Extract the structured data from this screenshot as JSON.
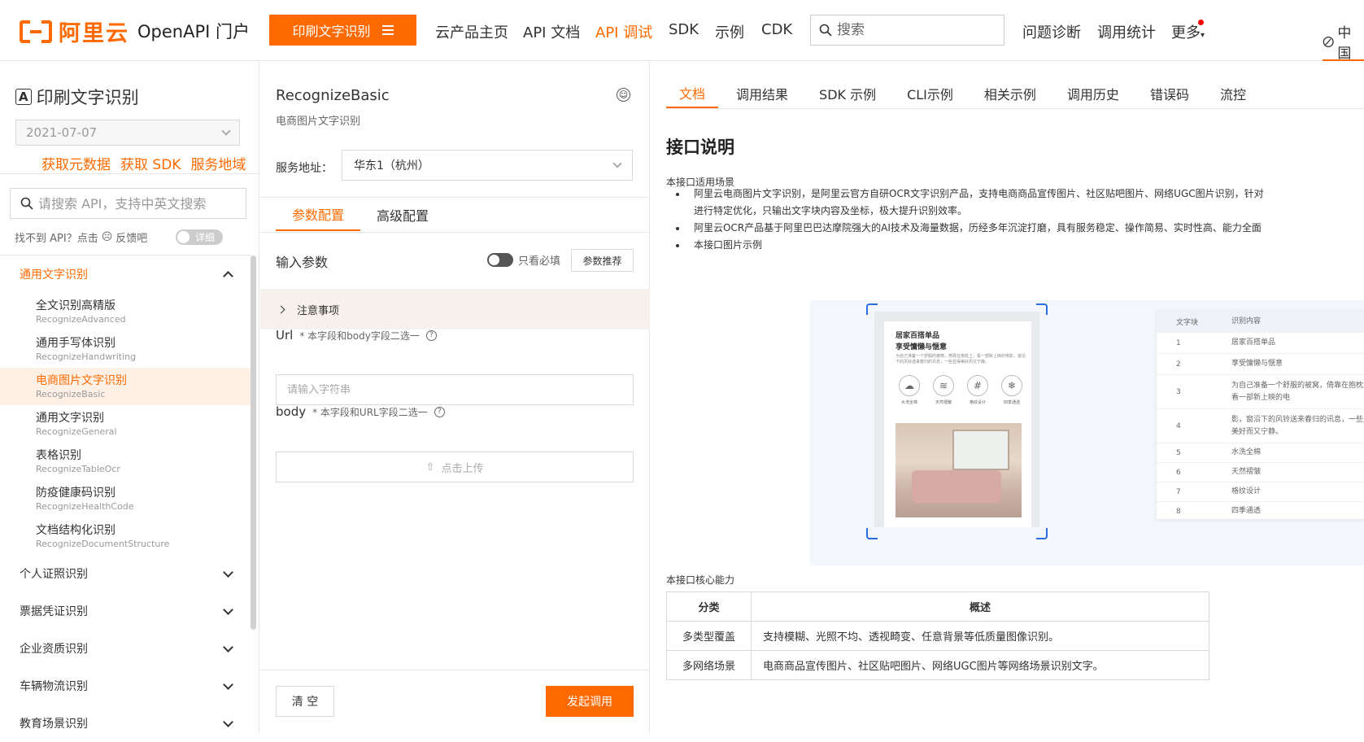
{
  "header": {
    "brand": "阿里云",
    "portal": "OpenAPI 门户",
    "product_button": "印刷文字识别",
    "nav": [
      {
        "label": "云产品主页",
        "active": false
      },
      {
        "label": "API 文档",
        "active": false
      },
      {
        "label": "API 调试",
        "active": true
      },
      {
        "label": "SDK",
        "active": false
      },
      {
        "label": "示例",
        "active": false
      },
      {
        "label": "CDK",
        "active": false
      }
    ],
    "search_placeholder": "搜索",
    "right_links": [
      "问题诊断",
      "调用统计",
      "更多"
    ],
    "region": "中国"
  },
  "sidebar": {
    "title": "印刷文字识别",
    "version": "2021-07-07",
    "links": [
      "获取元数据",
      "获取 SDK",
      "服务地域"
    ],
    "search_placeholder": "请搜索 API，支持中英文搜索",
    "feedback_text": "找不到 API？点击",
    "feedback_link": "反馈吧",
    "detail_toggle": "详细",
    "categories": [
      {
        "label": "通用文字识别",
        "open": true
      },
      {
        "label": "个人证照识别",
        "open": false
      },
      {
        "label": "票据凭证识别",
        "open": false
      },
      {
        "label": "企业资质识别",
        "open": false
      },
      {
        "label": "车辆物流识别",
        "open": false
      },
      {
        "label": "教育场景识别",
        "open": false
      }
    ],
    "items": [
      {
        "zh": "全文识别高精版",
        "en": "RecognizeAdvanced",
        "active": false
      },
      {
        "zh": "通用手写体识别",
        "en": "RecognizeHandwriting",
        "active": false
      },
      {
        "zh": "电商图片文字识别",
        "en": "RecognizeBasic",
        "active": true
      },
      {
        "zh": "通用文字识别",
        "en": "RecognizeGeneral",
        "active": false
      },
      {
        "zh": "表格识别",
        "en": "RecognizeTableOcr",
        "active": false
      },
      {
        "zh": "防疫健康码识别",
        "en": "RecognizeHealthCode",
        "active": false
      },
      {
        "zh": "文档结构化识别",
        "en": "RecognizeDocumentStructure",
        "active": false
      }
    ]
  },
  "middle": {
    "api_name": "RecognizeBasic",
    "api_desc": "电商图片文字识别",
    "service_label": "服务地址：",
    "service_value": "华东1（杭州）",
    "tabs": [
      "参数配置",
      "高级配置"
    ],
    "input_params": "输入参数",
    "required_only": "只看必填",
    "recommend": "参数推荐",
    "notice": "注意事项",
    "url_label": "Url",
    "url_hint": "* 本字段和body字段二选一",
    "url_placeholder": "请输入字符串",
    "body_label": "body",
    "body_hint": "* 本字段和URL字段二选一",
    "upload": "点击上传",
    "clear": "清 空",
    "call": "发起调用"
  },
  "doc": {
    "tabs": [
      "文档",
      "调用结果",
      "SDK 示例",
      "CLI示例",
      "相关示例",
      "调用历史",
      "错误码",
      "流控"
    ],
    "heading": "接口说明",
    "scene_label": "本接口适用场景",
    "bullets": [
      "阿里云电商图片文字识别，是阿里云官方自研OCR文字识别产品，支持电商商品宣传图片、社区贴吧图片、网络UGC图片识别，针对",
      "进行特定优化，只输出文字块内容及坐标，极大提升识别效率。",
      "阿里云OCR产品基于阿里巴巴达摩院强大的AI技术及海量数据，历经多年沉淀打磨，具有服务稳定、操作简易、实时性高、能力全面",
      "本接口图片示例"
    ],
    "example": {
      "t1": "居家百搭单品",
      "t2": "享受慵懒与惬意",
      "desc": "为自己准备一个舒服的被窝，倚靠在抱枕上，看一部新上映的电影，窗沿下的风铃送来春归的讯息，一些显得美好而又宁静。",
      "icons": [
        "水洗全棉",
        "天然褶皱",
        "格纹设计",
        "四季通透"
      ],
      "col_block": "文字块",
      "col_content": "识别内容",
      "rows": [
        {
          "n": "1",
          "text": "居家百搭单品"
        },
        {
          "n": "2",
          "text": "享受慵懒与惬意"
        },
        {
          "n": "3",
          "text": "为自己准备一个舒服的被窝，倚靠在抱枕上，看一部新上映的电"
        },
        {
          "n": "4",
          "text": "影，窗沿下的风铃送来春归的讯息，一些显得美好而又宁静。"
        },
        {
          "n": "5",
          "text": "水洗全棉"
        },
        {
          "n": "6",
          "text": "天然褶皱"
        },
        {
          "n": "7",
          "text": "格纹设计"
        },
        {
          "n": "8",
          "text": "四季通透"
        }
      ]
    },
    "capability_label": "本接口核心能力",
    "cap_headers": [
      "分类",
      "概述"
    ],
    "cap_rows": [
      {
        "k": "多类型覆盖",
        "v": "支持模糊、光照不均、透视畸变、任意背景等低质量图像识别。"
      },
      {
        "k": "多网络场景",
        "v": "电商商品宣传图片、社区贴吧图片、网络UGC图片等网络场景识别文字。"
      }
    ]
  },
  "colors": {
    "accent": "#ff6a00",
    "frame": "#2b6de3"
  }
}
